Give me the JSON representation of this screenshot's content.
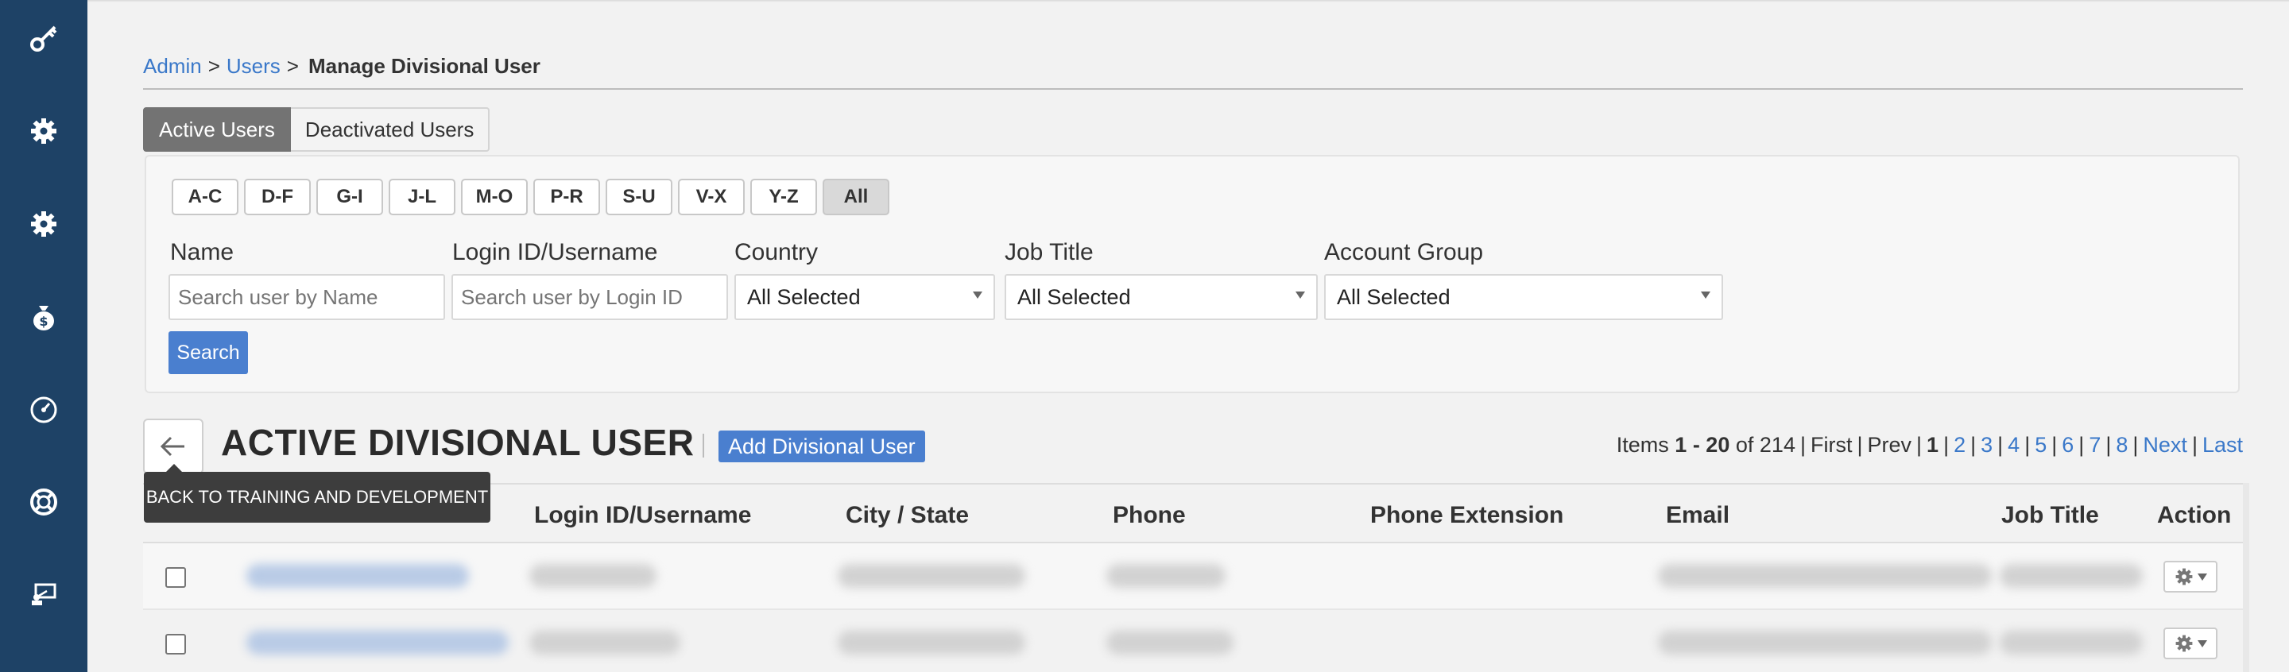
{
  "sidebar": {
    "icons": [
      "key-icon",
      "settings-gear-icon",
      "config-gear-icon",
      "money-bag-icon",
      "gauge-icon",
      "lifebuoy-icon",
      "presenter-icon"
    ]
  },
  "breadcrumb": {
    "admin": "Admin",
    "sep1": ">",
    "users": "Users",
    "sep2": ">",
    "current": "Manage Divisional User"
  },
  "tabs": {
    "active": "Active Users",
    "deactivated": "Deactivated Users"
  },
  "letter_filters": [
    "A-C",
    "D-F",
    "G-I",
    "J-L",
    "M-O",
    "P-R",
    "S-U",
    "V-X",
    "Y-Z",
    "All"
  ],
  "filters": {
    "name_label": "Name",
    "name_placeholder": "Search user by Name",
    "login_label": "Login ID/Username",
    "login_placeholder": "Search user by Login ID",
    "country_label": "Country",
    "country_value": "All Selected",
    "job_label": "Job Title",
    "job_value": "All Selected",
    "group_label": "Account Group",
    "group_value": "All Selected",
    "search_button": "Search"
  },
  "section": {
    "title": "ACTIVE DIVISIONAL USER",
    "add_button": "Add Divisional User",
    "tooltip": "BACK TO TRAINING AND DEVELOPMENT"
  },
  "pager": {
    "items_label": "Items",
    "range": "1 - 20",
    "of_label": "of",
    "total": "214",
    "first": "First",
    "prev": "Prev",
    "pages": [
      "1",
      "2",
      "3",
      "4",
      "5",
      "6",
      "7",
      "8"
    ],
    "next": "Next",
    "last": "Last"
  },
  "table": {
    "columns": [
      "Login ID/Username",
      "City /  State",
      "Phone",
      "Phone Extension",
      "Email",
      "Job Title",
      "Action"
    ]
  },
  "colors": {
    "sidebar": "#1e4266",
    "accent": "#4a7fcf",
    "link": "#3a78c9"
  }
}
